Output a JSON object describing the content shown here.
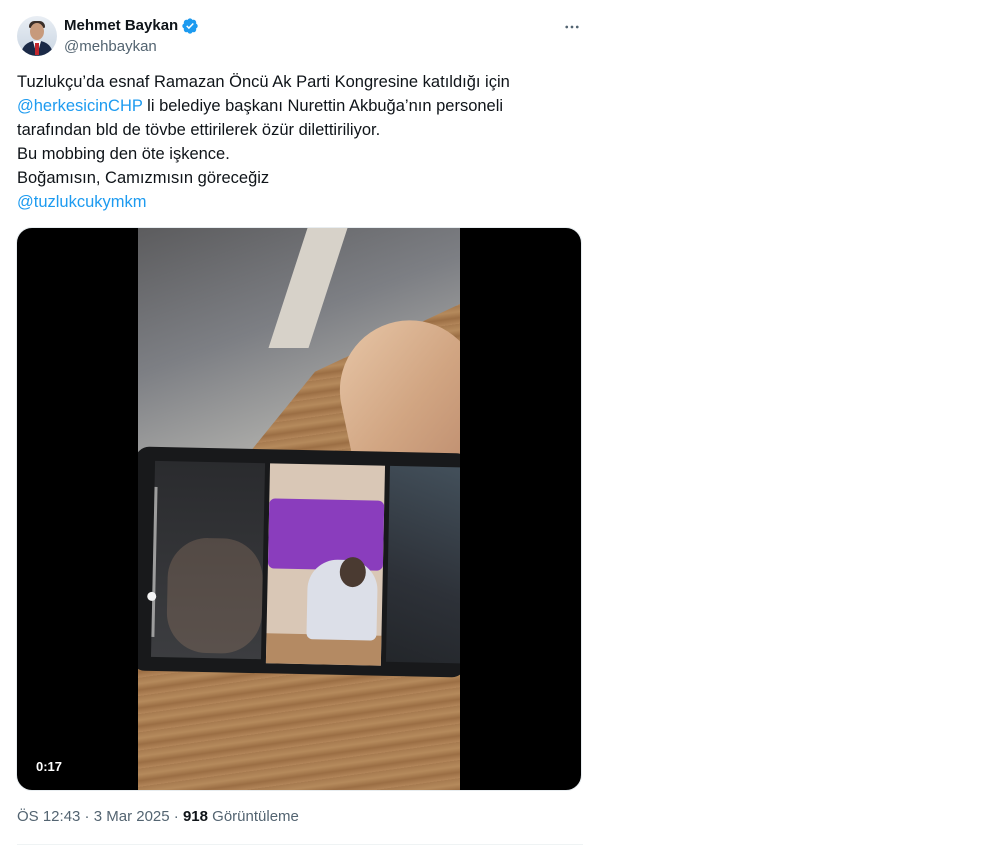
{
  "author": {
    "name": "Mehmet Baykan",
    "handle": "@mehbaykan",
    "verified": true,
    "verified_color": "#1d9bf0"
  },
  "tweet": {
    "line1": "Tuzlukçu’da esnaf Ramazan Öncü Ak Parti Kongresine katıldığı için",
    "line2_mention": "@herkesicinCHP",
    "line2_rest": " li belediye başkanı Nurettin Akbuğa’nın personeli",
    "line3": "tarafından bld de tövbe ettirilerek özür dilettiriliyor.",
    "line4": "Bu mobbing den öte işkence.",
    "line5": "Boğamısın, Camızmısın göreceğiz",
    "line6_mention": "@tuzlukcukymkm",
    "mention_color": "#1d9bf0"
  },
  "media": {
    "type": "video",
    "duration_label": "0:17"
  },
  "meta": {
    "time": "ÖS 12:43",
    "separator": " · ",
    "date": "3 Mar 2025",
    "views_count": "918",
    "views_label": " Görüntüleme"
  },
  "icons": {
    "more": "more-horizontal-icon",
    "verified": "verified-badge-icon"
  }
}
